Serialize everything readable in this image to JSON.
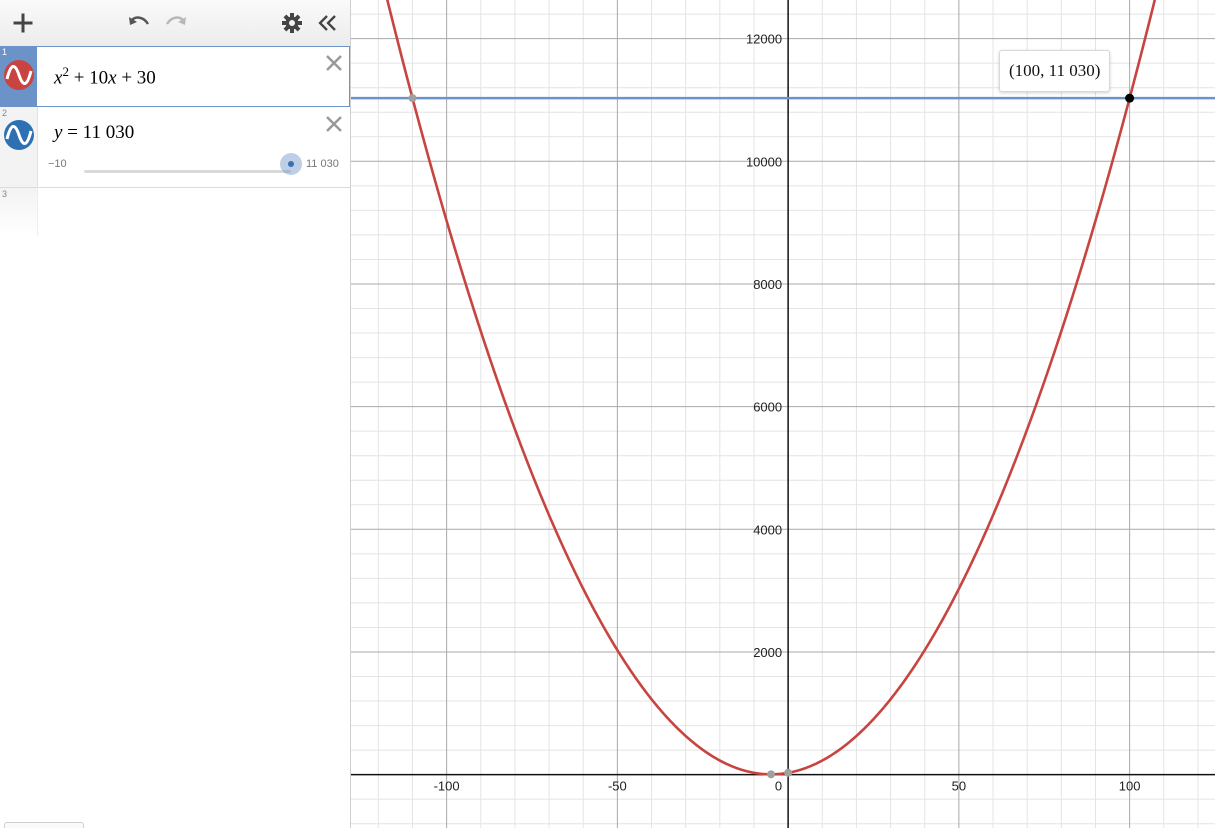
{
  "toolbar": {
    "add_icon": "plus-icon",
    "undo_icon": "undo-icon",
    "redo_icon": "redo-icon",
    "settings_icon": "gear-icon",
    "collapse_icon": "double-chevron-left-icon"
  },
  "expressions": [
    {
      "index": "1",
      "color": "#c74440",
      "lhs_var": "x",
      "exponent": "2",
      "rhs_tail": " + 10",
      "var2": "x",
      "tail2": " + 30"
    },
    {
      "index": "2",
      "color": "#2d70b3",
      "lhs_var": "y",
      "equals_value": " = 11 030",
      "slider": {
        "min_label": "−10",
        "max_label": "11 030",
        "value": 11030,
        "min": -10,
        "max": 11030
      }
    },
    {
      "index": "3"
    }
  ],
  "tooltip": {
    "text": "(100, 11 030)"
  },
  "graph": {
    "x_range": [
      -128,
      125
    ],
    "y_range": [
      -870,
      12630
    ],
    "x_ticks": [
      -100,
      -50,
      50,
      100
    ],
    "y_ticks": [
      2000,
      4000,
      6000,
      8000,
      10000,
      12000
    ],
    "x_tick_labels": [
      "-100",
      "-50",
      "50",
      "100"
    ],
    "y_tick_labels": [
      "2000",
      "4000",
      "6000",
      "8000",
      "10000",
      "12000"
    ],
    "origin_label": "0",
    "curve_color": "#c74440",
    "line_color": "#6c93c8",
    "horizontal_line_y": 11030,
    "point_of_interest": [
      100,
      11030
    ],
    "intersection_other": [
      -110,
      11030
    ],
    "vertex": [
      -5,
      5
    ],
    "y_intercept": [
      0,
      30
    ]
  }
}
